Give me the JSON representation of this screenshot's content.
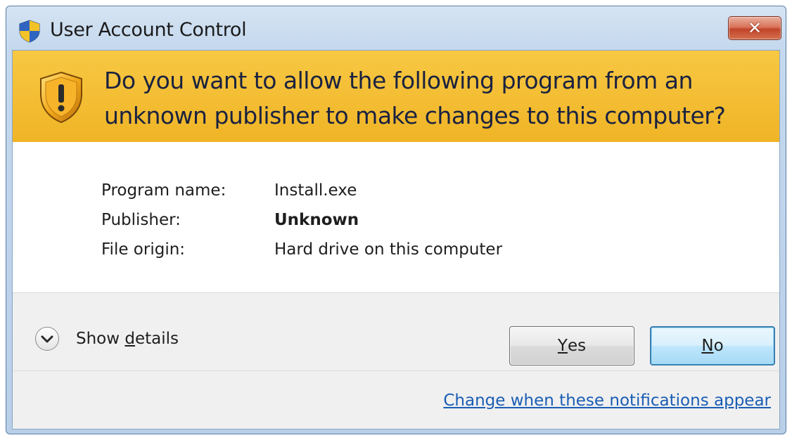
{
  "window": {
    "title": "User Account Control",
    "title_icon": "uac-shield-icon",
    "close_icon": "close-icon",
    "close_symbol": "✕"
  },
  "banner": {
    "icon": "warning-shield-icon",
    "line1": "Do you want to allow the following program from an",
    "line2": "unknown publisher to make changes to this computer?"
  },
  "info": {
    "program_label": "Program name:",
    "program_value": "Install.exe",
    "publisher_label": "Publisher:",
    "publisher_value": "Unknown",
    "origin_label": "File origin:",
    "origin_value": "Hard drive on this computer"
  },
  "footer": {
    "details_icon": "chevron-down-icon",
    "details_prefix": "Show ",
    "details_mnemonic": "d",
    "details_suffix": "etails",
    "yes_mnemonic": "Y",
    "yes_rest": "es",
    "no_mnemonic": "N",
    "no_rest": "o",
    "notifications_link": "Change when these notifications appear"
  },
  "colors": {
    "banner": "#f0b426",
    "link": "#1a5db4",
    "default_button_border": "#3c7fb1"
  }
}
